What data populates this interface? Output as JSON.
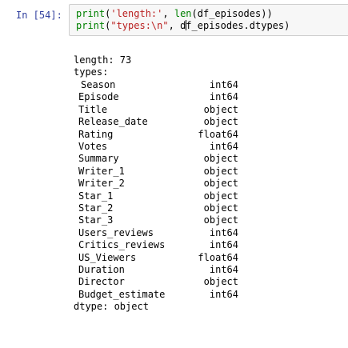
{
  "cell": {
    "prompt": "In [54]:",
    "code": {
      "line1": {
        "fn": "print",
        "open": "(",
        "str": "'length:'",
        "sep": ", ",
        "fn2": "len",
        "args": "(df_episodes))"
      },
      "line2": {
        "fn": "print",
        "open": "(",
        "str": "\"types:\\n\"",
        "sep": ", ",
        "arg_before_cursor": "d",
        "arg_after_cursor": "f_episodes.dtypes)"
      }
    },
    "output": {
      "length_line": "length: 73",
      "types_line": "types:",
      "rows": [
        {
          "name": "Season",
          "type": "int64"
        },
        {
          "name": "Episode",
          "type": "int64"
        },
        {
          "name": "Title",
          "type": "object"
        },
        {
          "name": "Release_date",
          "type": "object"
        },
        {
          "name": "Rating",
          "type": "float64"
        },
        {
          "name": "Votes",
          "type": "int64"
        },
        {
          "name": "Summary",
          "type": "object"
        },
        {
          "name": "Writer_1",
          "type": "object"
        },
        {
          "name": "Writer_2",
          "type": "object"
        },
        {
          "name": "Star_1",
          "type": "object"
        },
        {
          "name": "Star_2",
          "type": "object"
        },
        {
          "name": "Star_3",
          "type": "object"
        },
        {
          "name": "Users_reviews",
          "type": "int64"
        },
        {
          "name": "Critics_reviews",
          "type": "int64"
        },
        {
          "name": "US_Viewers",
          "type": "float64"
        },
        {
          "name": "Duration",
          "type": "int64"
        },
        {
          "name": "Director",
          "type": "object"
        },
        {
          "name": "Budget_estimate",
          "type": "int64"
        }
      ],
      "dtype_line": "dtype: object"
    }
  }
}
